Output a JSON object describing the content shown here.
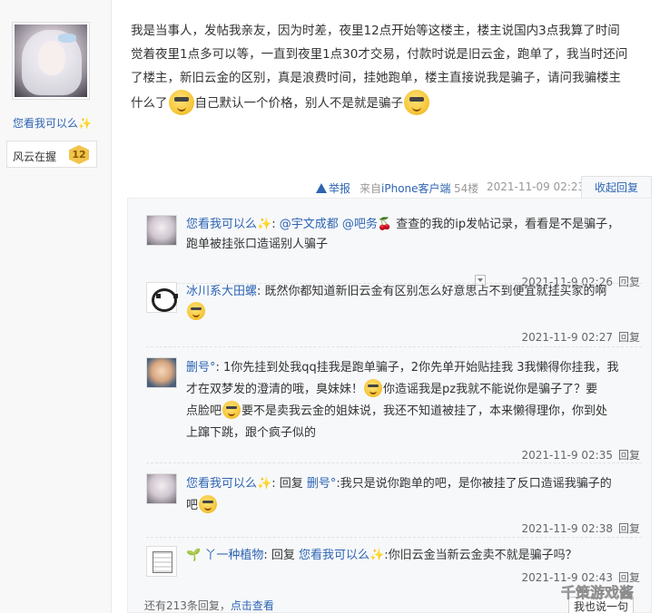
{
  "author": {
    "name": "您看我可以么",
    "badge_label": "风云在握",
    "level": "12"
  },
  "post": {
    "line1": "我是当事人，发帖我亲友，因为时差，夜里12点开始等这楼主，楼主说国内3点我算了时间",
    "line2": "觉着夜里1点多可以等，一直到夜里1点30才交易，付款时说是旧云金，跑单了，我当时还问",
    "line3": "了楼主，新旧云金的区别，真是浪费时间，挂她跑单，楼主直接说我是骗子，请问我骗楼主",
    "line4_a": "什么了",
    "line4_b": "自己默认一个价格，别人不是就是骗子"
  },
  "footer": {
    "report": "举报",
    "from_prefix": "来自",
    "from_client": "iPhone客户端",
    "floor": "54楼",
    "time": "2021-11-09 02:23",
    "collapse": "收起回复"
  },
  "replies": [
    {
      "name": "您看我可以么",
      "at1": "@宇文成都",
      "at2": "@吧务",
      "text1": "查查的我的ip发帖记录，看看是不是骗子，",
      "text2": "跑单被挂张口造谣别人骗子",
      "time": "2021-11-9 02:26",
      "reply": "回复"
    },
    {
      "name": "冰川系大田螺",
      "text1": "既然你都知道新旧云金有区别怎么好意思占不到便宜就挂买家的啊",
      "time": "2021-11-9 02:27",
      "reply": "回复"
    },
    {
      "name": "删号°",
      "text1": "1你先挂到处我qq挂我是跑单骗子，2你先单开始贴挂我 3我懒得你挂我，我",
      "text2a": "才在双梦发的澄清的哦，臭妹妹！",
      "text2b": "你造谣我是pz我就不能说你是骗子了？要",
      "text3a": "点脸吧",
      "text3b": "要不是卖我云金的姐妹说，我还不知道被挂了，本来懒得理你，你到处",
      "text4": "上蹿下跳，跟个疯子似的",
      "time": "2021-11-9 02:35",
      "reply": "回复"
    },
    {
      "name": "您看我可以么",
      "reply_word": "回复",
      "target": "删号°",
      "text1": ":我只是说你跑单的吧，是你被挂了反口造谣我骗子的",
      "text2": "吧",
      "time": "2021-11-9 02:38",
      "reply": "回复"
    },
    {
      "name": "丫一种植物",
      "reply_word": "回复",
      "target": "您看我可以么",
      "text1": ":你旧云金当新云金卖不就是骗子吗？",
      "time": "2021-11-9 02:43",
      "reply": "回复"
    }
  ],
  "more": {
    "count_text": "还有213条回复，",
    "link": "点击查看"
  },
  "say_button": "我也说一句",
  "watermark": "千策游戏酱",
  "colors": {
    "link": "#2d64b3",
    "text": "#333333",
    "muted": "#999999",
    "reply_bg": "#f7f8fa"
  }
}
